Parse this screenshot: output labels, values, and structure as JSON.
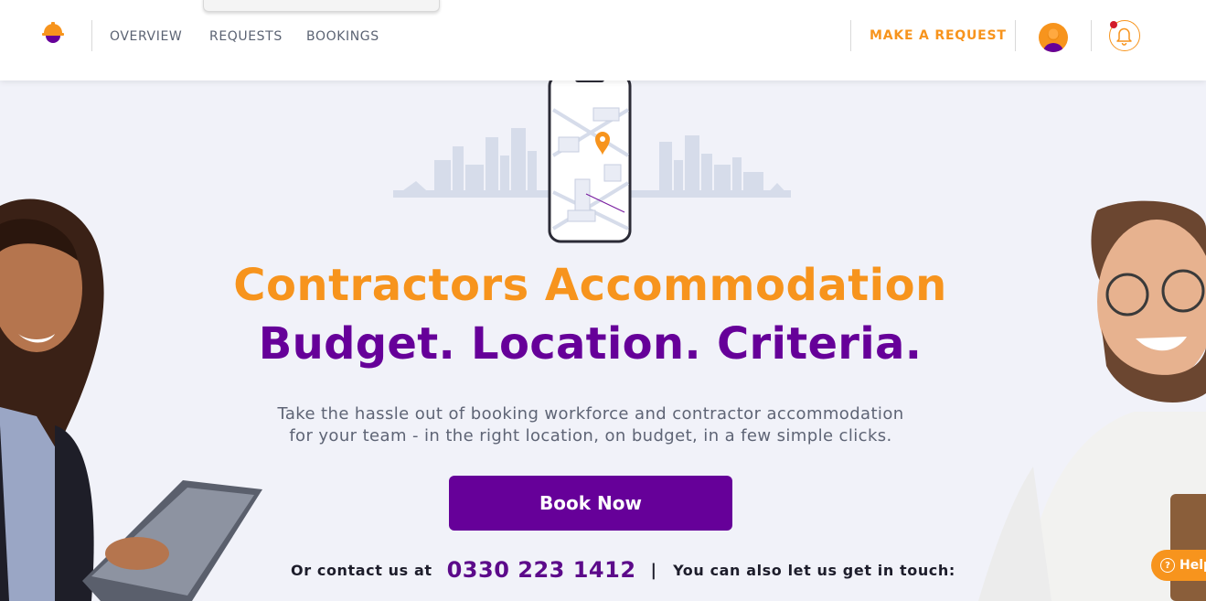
{
  "nav": {
    "items": [
      "OVERVIEW",
      "REQUESTS",
      "BOOKINGS"
    ],
    "make_request": "MAKE A REQUEST"
  },
  "hero": {
    "headline_1": "Contractors Accommodation",
    "headline_2": "Budget. Location. Criteria.",
    "subtitle_line_1": "Take the hassle out of booking workforce and contractor accommodation",
    "subtitle_line_2": "for your team - in the right location, on budget, in a few simple clicks.",
    "cta": "Book Now"
  },
  "contact": {
    "label": "Or contact us at",
    "phone": "0330 223 1412",
    "separator": "|",
    "get_in_touch": "You can also let us get in touch:"
  },
  "help": {
    "label": "Help",
    "icon": "?"
  },
  "icons": {
    "logo": "hard-hat-logo-icon",
    "avatar": "user-avatar-icon",
    "bell": "notification-bell-icon",
    "help": "help-circle-icon"
  },
  "colors": {
    "accent_orange": "#f7941d",
    "brand_purple": "#660099",
    "background": "#f1f2f9",
    "notification_dot": "#d21b2a"
  }
}
